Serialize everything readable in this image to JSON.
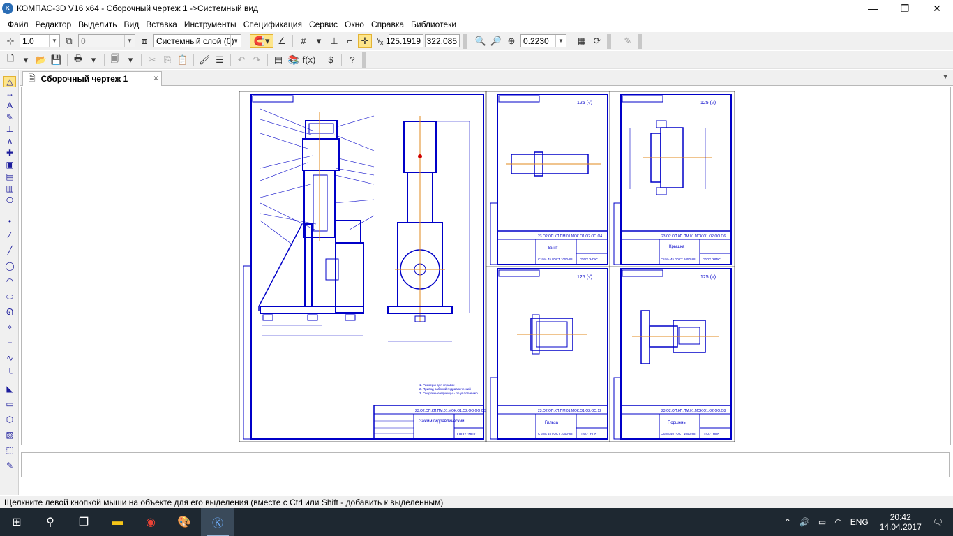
{
  "window": {
    "title": "КОМПАС-3D V16  x64 - Сборочный чертеж 1 ->Системный вид",
    "minimize": "—",
    "maximize": "❐",
    "close": "✕"
  },
  "menu": [
    "Файл",
    "Редактор",
    "Выделить",
    "Вид",
    "Вставка",
    "Инструменты",
    "Спецификация",
    "Сервис",
    "Окно",
    "Справка",
    "Библиотеки"
  ],
  "toolbar1": {
    "scale_value": "1.0",
    "style_value": "0",
    "layer_value": "Системный слой (0)",
    "coord_x": "125.1919",
    "coord_y": "322.085",
    "zoom_value": "0.2230"
  },
  "tab": {
    "title": "Сборочный чертеж 1",
    "close": "×"
  },
  "status": {
    "hint": "Щелкните левой кнопкой мыши на объекте для его выделения (вместе с Ctrl или Shift - добавить к выделенным)"
  },
  "taskbar": {
    "lang": "ENG",
    "time": "20:42",
    "date": "14.04.2017"
  },
  "drawing": {
    "main": {
      "doc_number": "23.О2.ОП.КП.ПМ.01.МОК.О1.О2.ОО.ОО СБ",
      "name": "Зажим гидравлический",
      "org": "ГПОУ \"НПК\"",
      "notes": [
        "1. Размеры для справок",
        "2. Привод рабочий гидравлический",
        "3. Сборочные единицы - по уплотнению"
      ]
    },
    "sheets": [
      {
        "doc_number": "23.О2.ОП.КП.ПМ.01.МОК.О1.О2.ОО.О4",
        "name": "Винт",
        "material": "Сталь 45 ГОСТ 1050-88",
        "org": "ГПОУ \"НПК\"",
        "roughness": "125 (√)"
      },
      {
        "doc_number": "23.О2.ОП.КП.ПМ.01.МОК.О1.О2.ОО.О6",
        "name": "Крышка",
        "material": "Сталь 45 ГОСТ 1050-88",
        "org": "ГПОУ \"НПК\"",
        "roughness": "125 (√)"
      },
      {
        "doc_number": "23.О2.ОП.КП.ПМ.01.МОК.О1.О2.ОО.12",
        "name": "Гильза",
        "material": "Сталь 45 ГОСТ 1050-88",
        "org": "ГПОУ \"НПК\"",
        "roughness": "125 (√)"
      },
      {
        "doc_number": "23.О2.ОП.КП.ПМ.01.МОК.О1.О2.ОО.О8",
        "name": "Поршень",
        "material": "Сталь 40 ГОСТ 1050-88",
        "org": "ГПОУ \"НПК\"",
        "roughness": "125 (√)"
      }
    ]
  }
}
